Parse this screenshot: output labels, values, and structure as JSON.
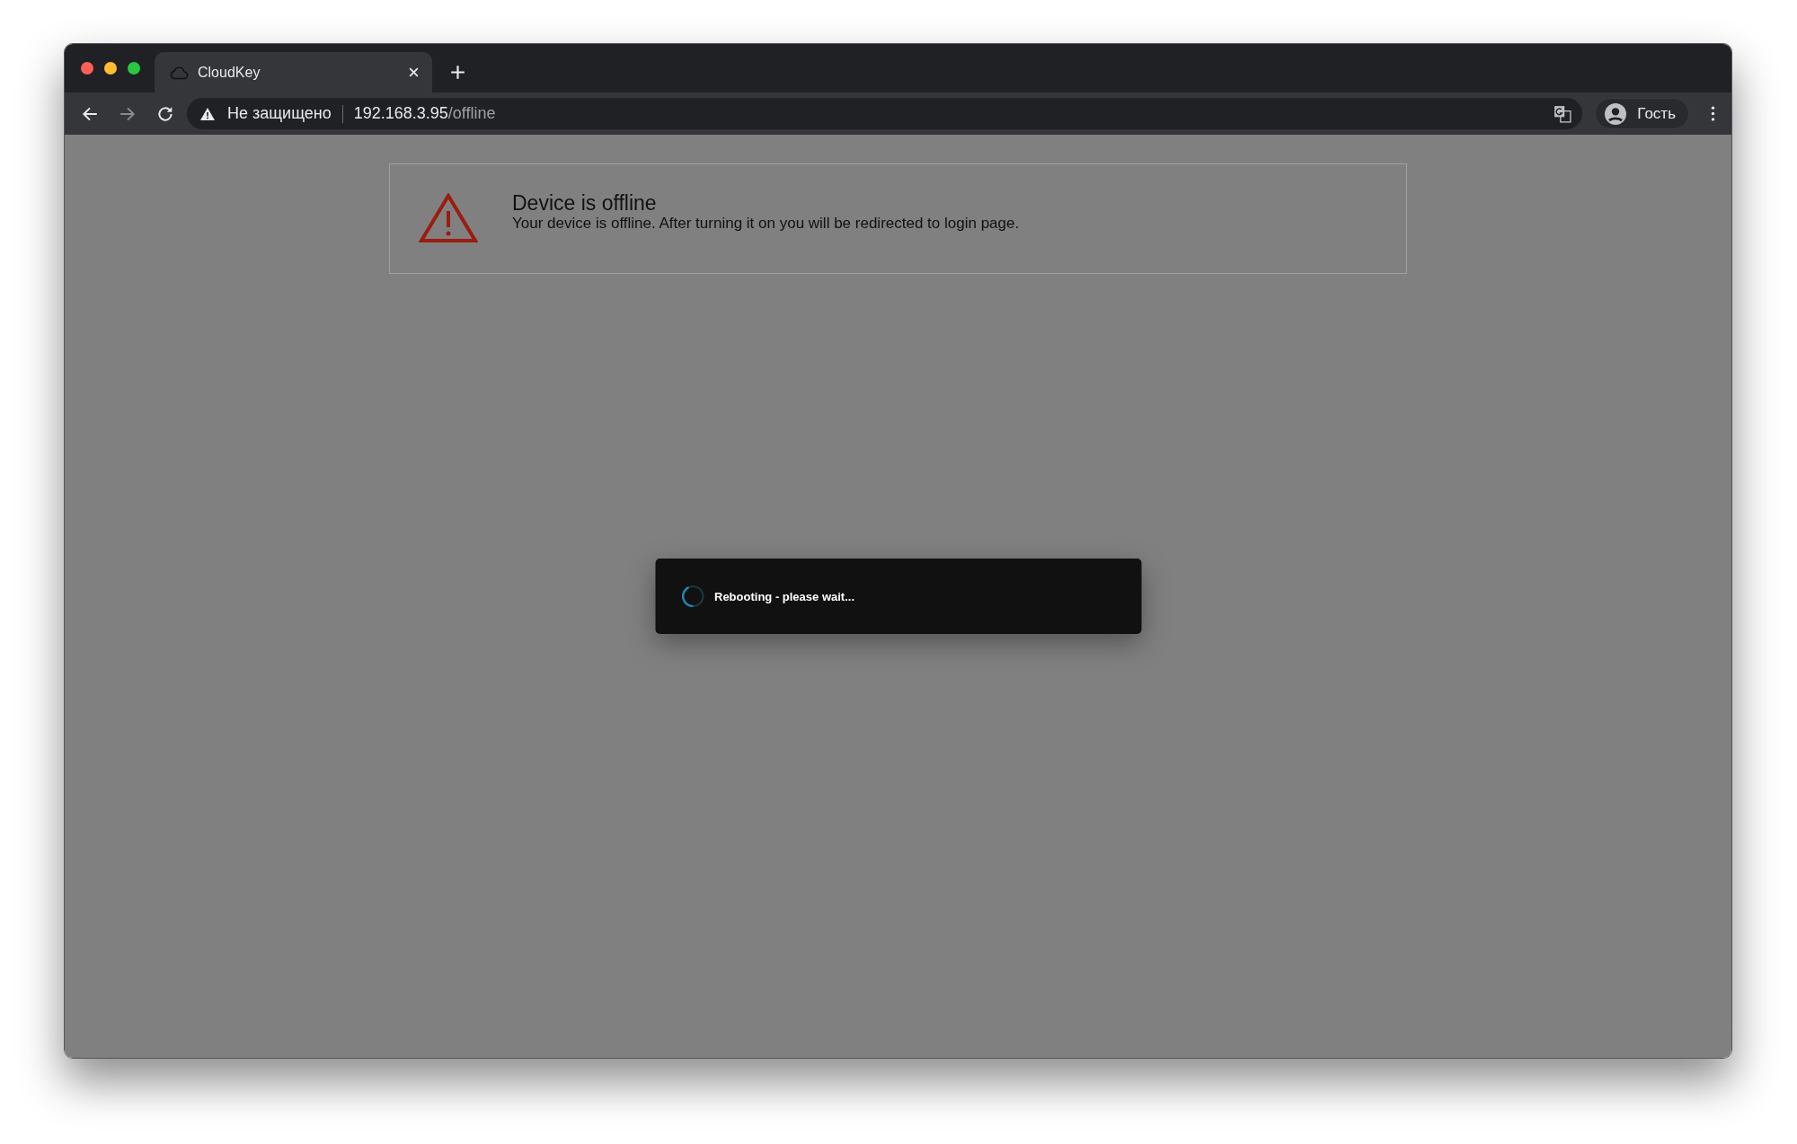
{
  "browser": {
    "tab": {
      "title": "CloudKey",
      "selected": true
    },
    "security_label": "Не защищено",
    "url": {
      "host": "192.168.3.95",
      "path": "/offline"
    },
    "profile": "Гость"
  },
  "alert": {
    "title": "Device is offline",
    "message": "Your device is offline. After turning it on you will be redirected to login page."
  },
  "dialog": {
    "message": "Rebooting - please wait..."
  }
}
